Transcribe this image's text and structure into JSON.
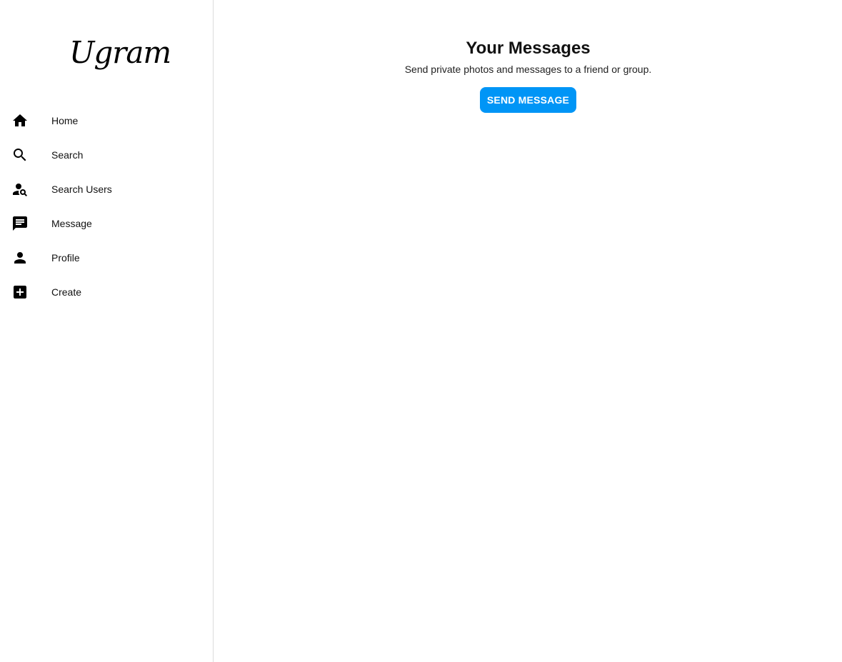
{
  "brand": {
    "logo_text": "Ugram"
  },
  "sidebar": {
    "items": [
      {
        "label": "Home",
        "icon": "home-icon"
      },
      {
        "label": "Search",
        "icon": "search-icon"
      },
      {
        "label": "Search Users",
        "icon": "user-search-icon"
      },
      {
        "label": "Message",
        "icon": "message-icon"
      },
      {
        "label": "Profile",
        "icon": "person-icon"
      },
      {
        "label": "Create",
        "icon": "add-box-icon"
      }
    ]
  },
  "main": {
    "title": "Your Messages",
    "subtitle": "Send private photos and messages to a friend or group.",
    "send_button_label": "SEND MESSAGE"
  },
  "colors": {
    "accent": "#0095f6",
    "divider": "#dbdbdb",
    "text": "#111111"
  }
}
